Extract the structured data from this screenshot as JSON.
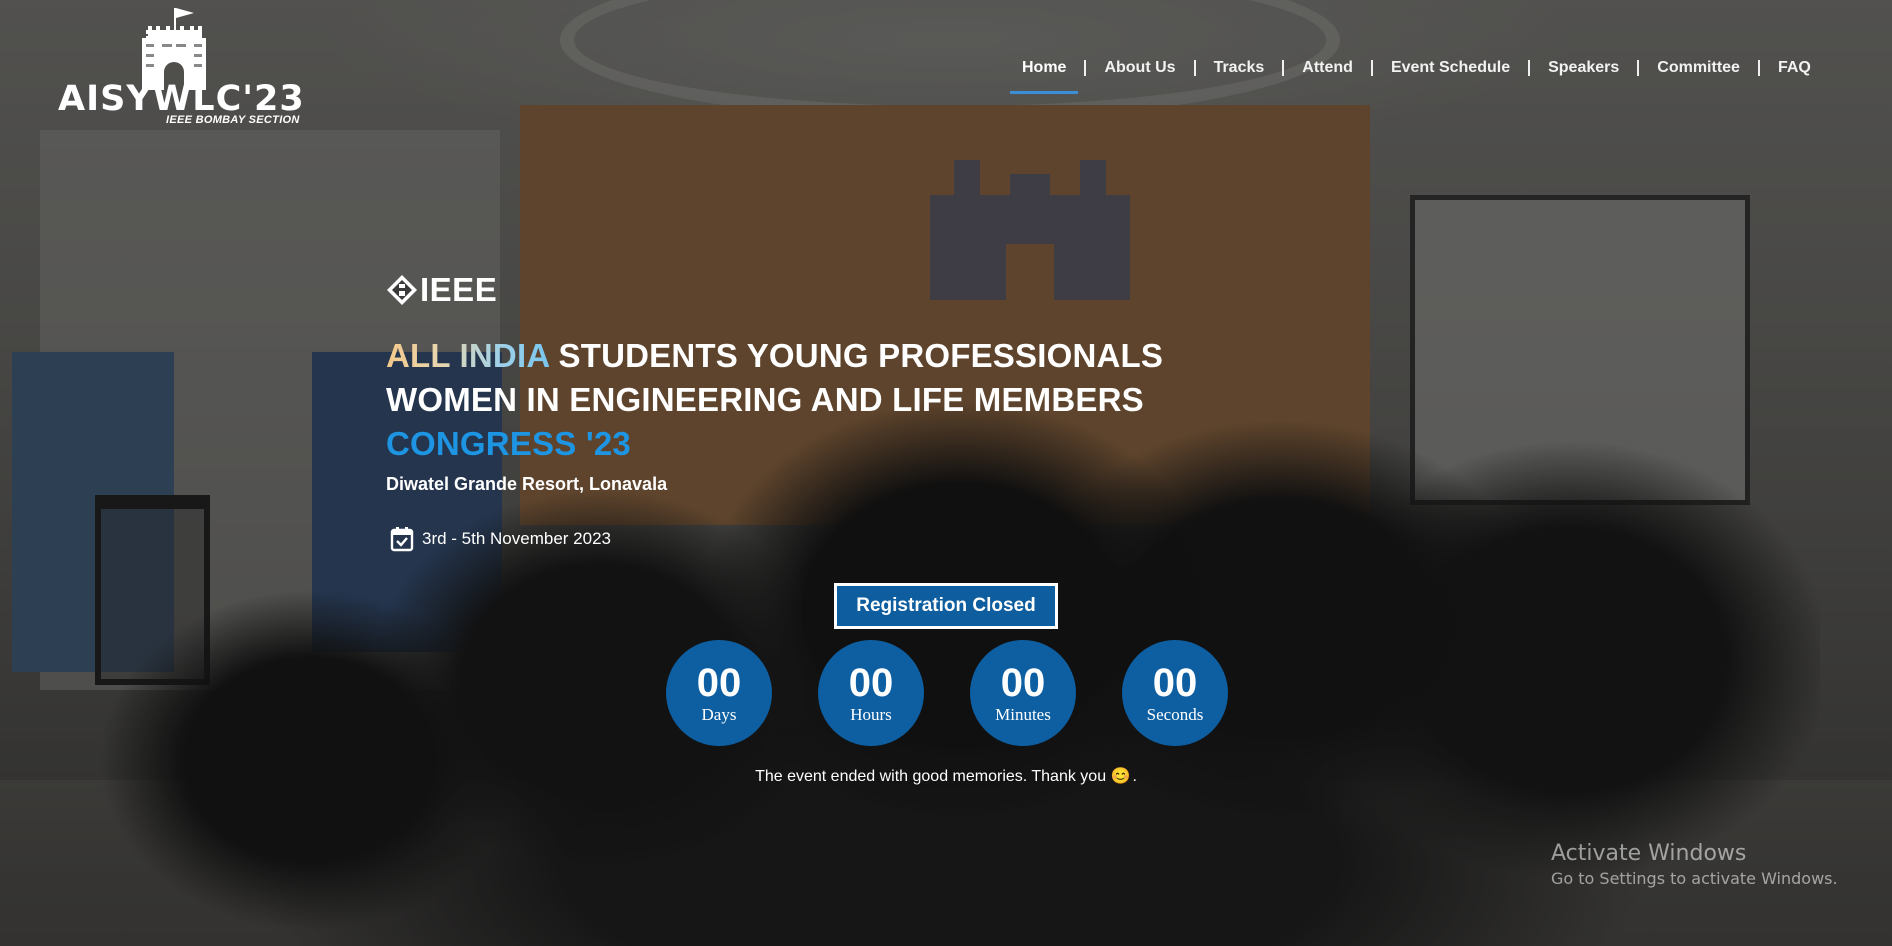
{
  "brand": {
    "name": "AISYWLC'23",
    "subtitle": "IEEE BOMBAY SECTION",
    "logo_icon": "castle-icon"
  },
  "nav": {
    "items": [
      {
        "label": "Home",
        "active": true
      },
      {
        "label": "About Us"
      },
      {
        "label": "Tracks"
      },
      {
        "label": "Attend"
      },
      {
        "label": "Event Schedule"
      },
      {
        "label": "Speakers"
      },
      {
        "label": "Committee"
      },
      {
        "label": "FAQ"
      }
    ],
    "active_underline_color": "#3a8fd6"
  },
  "hero": {
    "ieee_label": "IEEE",
    "headline": {
      "line1_highlight": "ALL INDIA",
      "line1_rest": " STUDENTS YOUNG PROFESSIONALS",
      "line2": "WOMEN IN ENGINEERING AND LIFE MEMBERS",
      "line3": "CONGRESS '23"
    },
    "venue": "Diwatel Grande Resort, Lonavala",
    "date_icon": "calendar-check-icon",
    "date": "3rd - 5th November 2023",
    "registration_button": "Registration Closed",
    "countdown": [
      {
        "value": "00",
        "label": "Days"
      },
      {
        "value": "00",
        "label": "Hours"
      },
      {
        "value": "00",
        "label": "Minutes"
      },
      {
        "value": "00",
        "label": "Seconds"
      }
    ],
    "end_message": "The event ended with good memories. Thank you",
    "end_message_emoji": "😊",
    "end_message_tail": ".",
    "accent_color": "#0d5fa2",
    "highlight_blue": "#1d95e2"
  },
  "watermark": {
    "title": "Activate Windows",
    "subtitle": "Go to Settings to activate Windows."
  }
}
